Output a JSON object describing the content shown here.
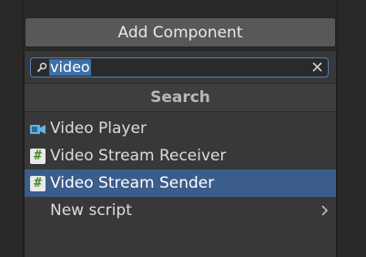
{
  "toolbar": {
    "add_component_label": "Add Component"
  },
  "search": {
    "value": "video"
  },
  "dropdown": {
    "header": "Search",
    "items": [
      {
        "label": "Video Player",
        "icon": "video-camera-icon"
      },
      {
        "label": "Video Stream Receiver",
        "icon": "script-hash-icon"
      },
      {
        "label": "Video Stream Sender",
        "icon": "script-hash-icon",
        "selected": true
      },
      {
        "label": "New script",
        "icon": "chevron-right-icon"
      }
    ]
  },
  "colors": {
    "selection": "#3b5d8c",
    "focus_border": "#4f82b8",
    "panel": "#383838"
  }
}
